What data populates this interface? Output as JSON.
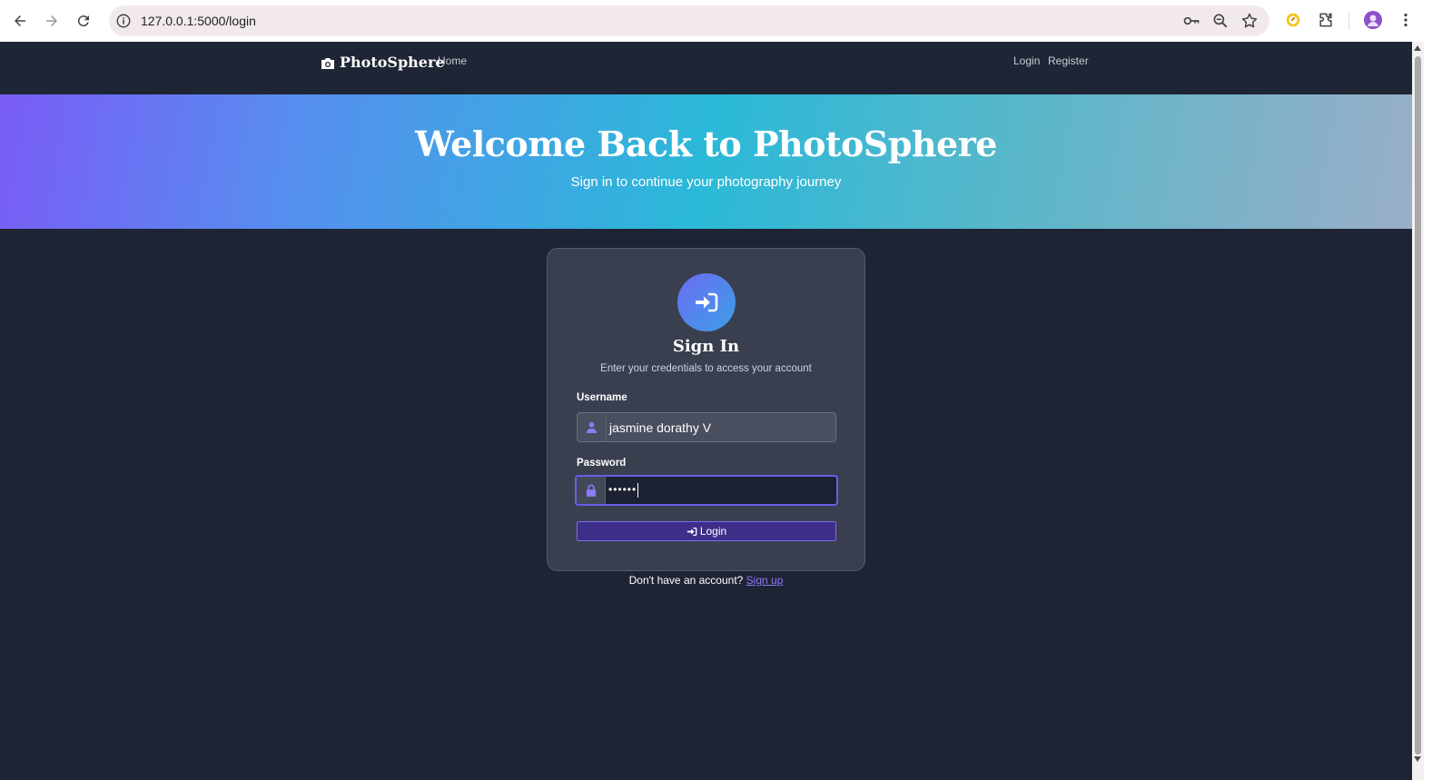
{
  "browser": {
    "url": "127.0.0.1:5000/login"
  },
  "navbar": {
    "brand": "PhotoSphere",
    "home": "Home",
    "login": "Login",
    "register": "Register"
  },
  "hero": {
    "title": "Welcome Back to PhotoSphere",
    "subtitle": "Sign in to continue your photography journey"
  },
  "card": {
    "title": "Sign In",
    "subtitle": "Enter your credentials to access your account",
    "username_label": "Username",
    "username_value": "jasmine dorathy V",
    "password_label": "Password",
    "password_value": "••••••",
    "login_button": "Login"
  },
  "footer": {
    "prompt": "Don't have an account?",
    "signup_link": "Sign up"
  },
  "colors": {
    "background": "#1f2435",
    "accent": "#6d5ce8",
    "card": "#3a3f50"
  },
  "icons": [
    "back-icon",
    "forward-icon",
    "reload-icon",
    "info-icon",
    "key-icon",
    "zoom-icon",
    "star-icon",
    "extension-icon",
    "puzzle-icon",
    "profile-icon",
    "menu-icon",
    "camera-icon",
    "sign-in-icon",
    "user-icon",
    "lock-icon"
  ]
}
